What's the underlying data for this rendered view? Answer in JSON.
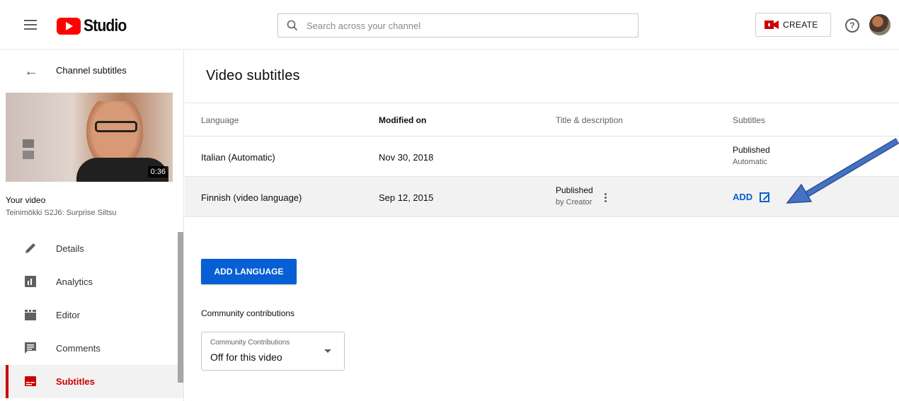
{
  "header": {
    "logo_text": "Studio",
    "search_placeholder": "Search across your channel",
    "create_label": "CREATE",
    "help_symbol": "?"
  },
  "sidebar": {
    "back_label": "Channel subtitles",
    "thumbnail_duration": "0:36",
    "your_video_label": "Your video",
    "video_title": "Teinimökki S2J6: Surprise Siltsu",
    "items": [
      {
        "label": "Details",
        "icon": "pencil-icon"
      },
      {
        "label": "Analytics",
        "icon": "analytics-icon"
      },
      {
        "label": "Editor",
        "icon": "clapper-icon"
      },
      {
        "label": "Comments",
        "icon": "comment-icon"
      },
      {
        "label": "Subtitles",
        "icon": "subtitles-icon",
        "active": true
      }
    ]
  },
  "main": {
    "page_title": "Video subtitles",
    "columns": [
      "Language",
      "Modified on",
      "Title & description",
      "Subtitles"
    ],
    "rows": [
      {
        "language": "Italian (Automatic)",
        "modified": "Nov 30, 2018",
        "title_status": "",
        "title_sub": "",
        "subtitles_status": "Published",
        "subtitles_sub": "Automatic"
      },
      {
        "language": "Finnish (video language)",
        "modified": "Sep 12, 2015",
        "title_status": "Published",
        "title_sub": "by Creator",
        "subtitles_action": "ADD"
      }
    ],
    "add_language_label": "ADD LANGUAGE",
    "community_label": "Community contributions",
    "community_select": {
      "small_label": "Community Contributions",
      "value": "Off for this video"
    }
  },
  "colors": {
    "accent_blue": "#065fd4",
    "brand_red": "#ff0000",
    "active_red": "#cc0000",
    "arrow_blue": "#4472c4"
  }
}
